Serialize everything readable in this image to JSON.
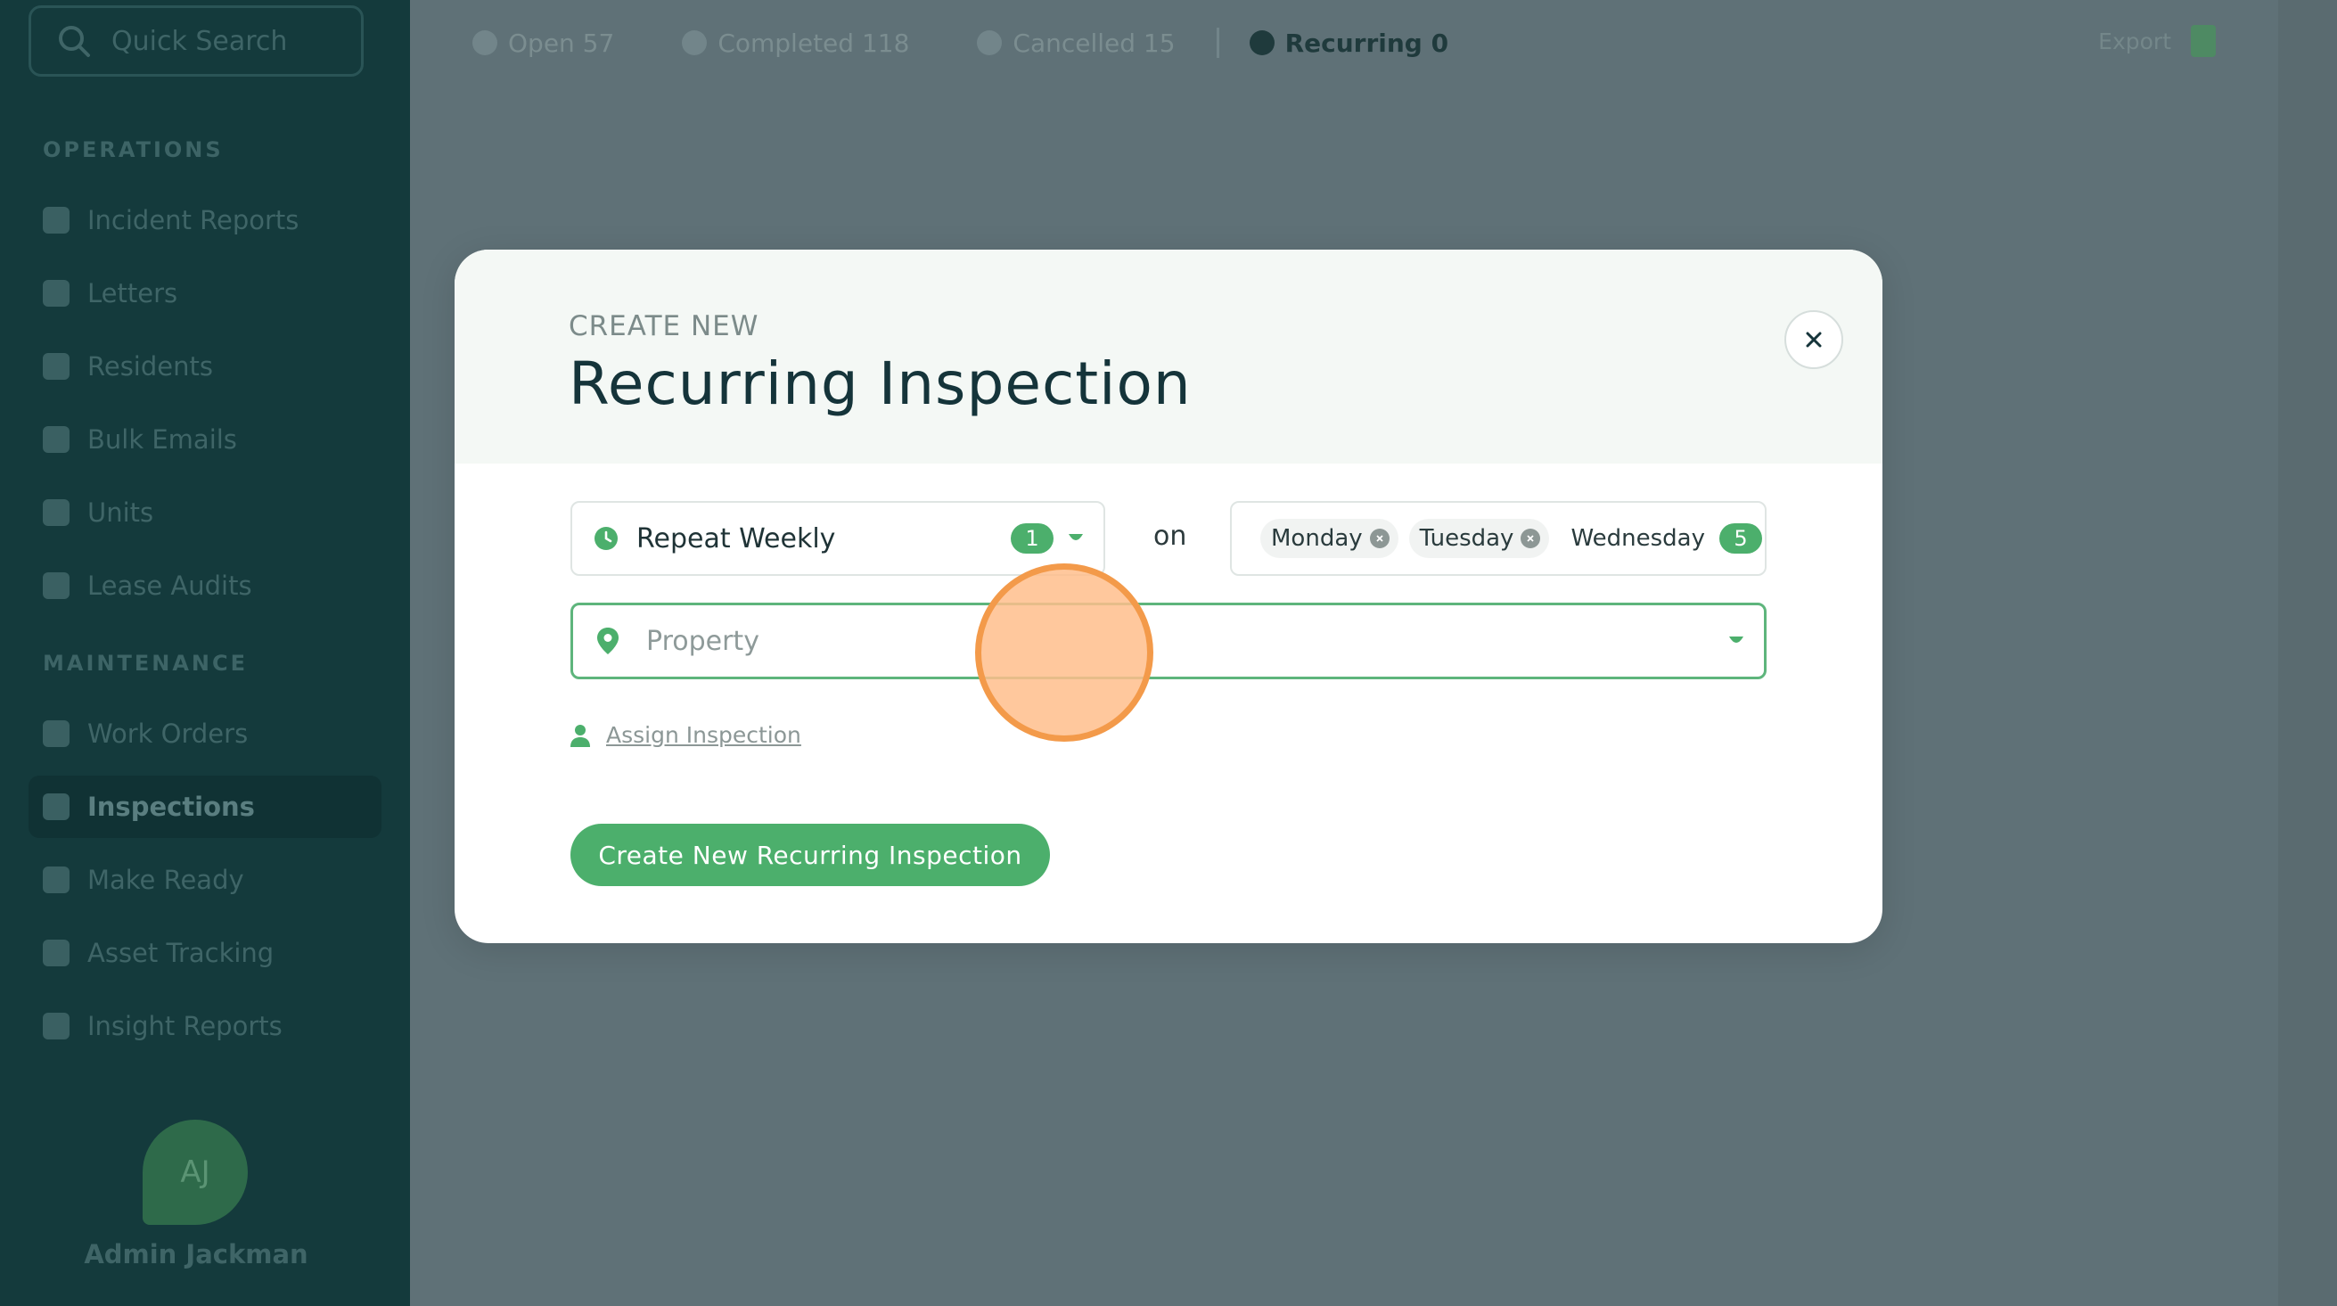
{
  "sidebar": {
    "search_placeholder": "Quick Search",
    "sections": [
      {
        "label": "OPERATIONS"
      },
      {
        "label": "MAINTENANCE"
      }
    ],
    "items": [
      {
        "label": "Incident Reports"
      },
      {
        "label": "Letters"
      },
      {
        "label": "Residents"
      },
      {
        "label": "Bulk Emails"
      },
      {
        "label": "Units"
      },
      {
        "label": "Lease Audits"
      },
      {
        "label": "Work Orders"
      },
      {
        "label": "Inspections",
        "active": true
      },
      {
        "label": "Make Ready"
      },
      {
        "label": "Asset Tracking"
      },
      {
        "label": "Insight Reports"
      }
    ],
    "user": {
      "initials": "AJ",
      "name": "Admin Jackman"
    }
  },
  "topbar": {
    "tabs": [
      {
        "label": "Open 57"
      },
      {
        "label": "Completed 118"
      },
      {
        "label": "Cancelled 15"
      },
      {
        "label": "Recurring 0",
        "active": true
      }
    ],
    "export_label": "Export"
  },
  "modal": {
    "eyebrow": "CREATE NEW",
    "title": "Recurring Inspection",
    "repeat": {
      "value": "Repeat Weekly",
      "count": "1"
    },
    "on_label": "on",
    "days": {
      "chips": [
        "Monday",
        "Tuesday",
        "Wednesday"
      ],
      "count": "5"
    },
    "property": {
      "placeholder": "Property"
    },
    "assign_label": "Assign Inspection",
    "submit_label": "Create New Recurring Inspection"
  },
  "colors": {
    "sidebar_bg": "#143a3c",
    "overlay_bg": "#5f7177",
    "accent_green": "#4caf6c",
    "title_text": "#15343a",
    "click_marker": "#f39a4a"
  }
}
